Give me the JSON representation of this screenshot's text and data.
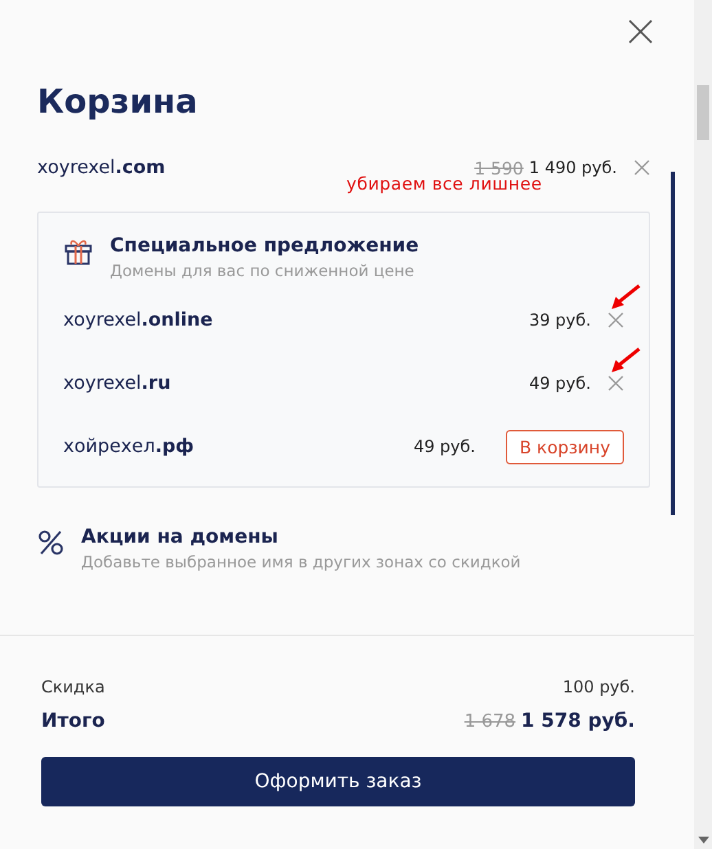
{
  "title": "Корзина",
  "cart_item": {
    "name": "xoyrexel**.com**",
    "old_price": "1 590",
    "price": "1 490 руб."
  },
  "annotation": "убираем все лишнее",
  "special_offer": {
    "title": "Специальное предложение",
    "subtitle": "Домены для вас по сниженной цене",
    "items": [
      {
        "kind": "in_cart",
        "name": "xoyrexel**.online**",
        "price": "39 руб.",
        "marked": true
      },
      {
        "kind": "in_cart",
        "name": "xoyrexel**.ru**",
        "price": "49 руб.",
        "marked": true
      },
      {
        "kind": "add",
        "name": "хойрехел**.рф**",
        "price": "49 руб.",
        "button": "В корзину"
      }
    ]
  },
  "promo": {
    "title": "Акции на домены",
    "subtitle": "Добавьте выбранное имя в других зонах со скидкой"
  },
  "summary": {
    "discount_label": "Скидка",
    "discount_value": "100 руб.",
    "total_label": "Итого",
    "old_total": "1 678",
    "total": "1 578 руб."
  },
  "checkout_button": "Оформить заказ"
}
